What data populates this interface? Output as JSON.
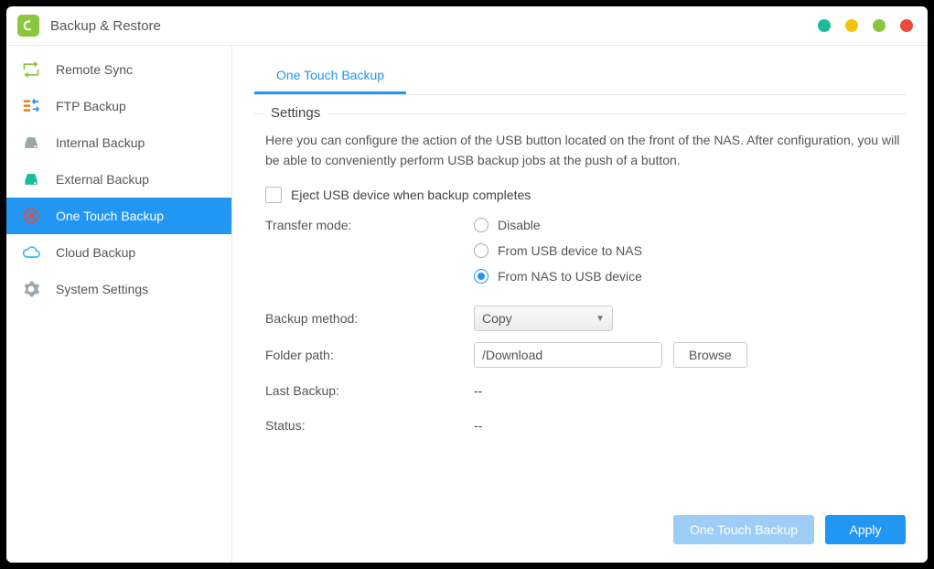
{
  "window": {
    "title": "Backup & Restore"
  },
  "sidebar": {
    "items": [
      {
        "id": "remote-sync",
        "label": "Remote Sync"
      },
      {
        "id": "ftp-backup",
        "label": "FTP Backup"
      },
      {
        "id": "internal-backup",
        "label": "Internal Backup"
      },
      {
        "id": "external-backup",
        "label": "External Backup"
      },
      {
        "id": "one-touch-backup",
        "label": "One Touch Backup"
      },
      {
        "id": "cloud-backup",
        "label": "Cloud Backup"
      },
      {
        "id": "system-settings",
        "label": "System Settings"
      }
    ],
    "selected": "one-touch-backup"
  },
  "tabs": {
    "active": "One Touch Backup"
  },
  "settings": {
    "legend": "Settings",
    "description": "Here you can configure the action of the USB button located on the front of the NAS. After configuration, you will be able to conveniently perform USB backup jobs at the push of a button.",
    "eject_label": "Eject USB device when backup completes",
    "eject_checked": false,
    "transfer_label": "Transfer mode:",
    "transfer_options": [
      {
        "id": "disable",
        "label": "Disable"
      },
      {
        "id": "usb2nas",
        "label": "From USB device to NAS"
      },
      {
        "id": "nas2usb",
        "label": "From NAS to USB device"
      }
    ],
    "transfer_selected": "nas2usb",
    "method_label": "Backup method:",
    "method_value": "Copy",
    "path_label": "Folder path:",
    "path_value": "/Download",
    "browse_label": "Browse",
    "last_label": "Last Backup:",
    "last_value": "--",
    "status_label": "Status:",
    "status_value": "--"
  },
  "footer": {
    "primary_light": "One Touch Backup",
    "primary_solid": "Apply"
  }
}
